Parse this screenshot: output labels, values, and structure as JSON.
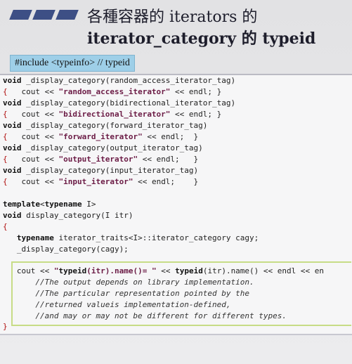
{
  "slide": {
    "title_line1": "各種容器的 iterators 的",
    "title_line2": "iterator_category 的 typeid",
    "include_label": "#include <typeinfo>  // typeid"
  },
  "code": {
    "lines": [
      "void _display_category(random_access_iterator_tag)",
      "{   cout << \"random_access_iterator\" << endl; }",
      "void _display_category(bidirectional_iterator_tag)",
      "{   cout << \"bidirectional_iterator\" << endl; }",
      "void _display_category(forward_iterator_tag)",
      "{   cout << \"forward_iterator\" << endl;  }",
      "void _display_category(output_iterator_tag)",
      "{   cout << \"output_iterator\" << endl;   }",
      "void _display_category(input_iterator_tag)",
      "{   cout << \"input_iterator\" << endl;    }",
      "",
      "template<typename I>",
      "void display_category(I itr)",
      "{",
      "   typename iterator_traits<I>::iterator_category cagy;",
      "   _display_category(cagy);",
      "",
      "   cout << \"typeid(itr).name()= \" << typeid(itr).name() << endl << en",
      "       //The output depends on library implementation.",
      "       //The particular representation pointed by the",
      "       //returned valueis implementation-defined,",
      "       //and may or may not be different for different types.",
      "}"
    ]
  }
}
